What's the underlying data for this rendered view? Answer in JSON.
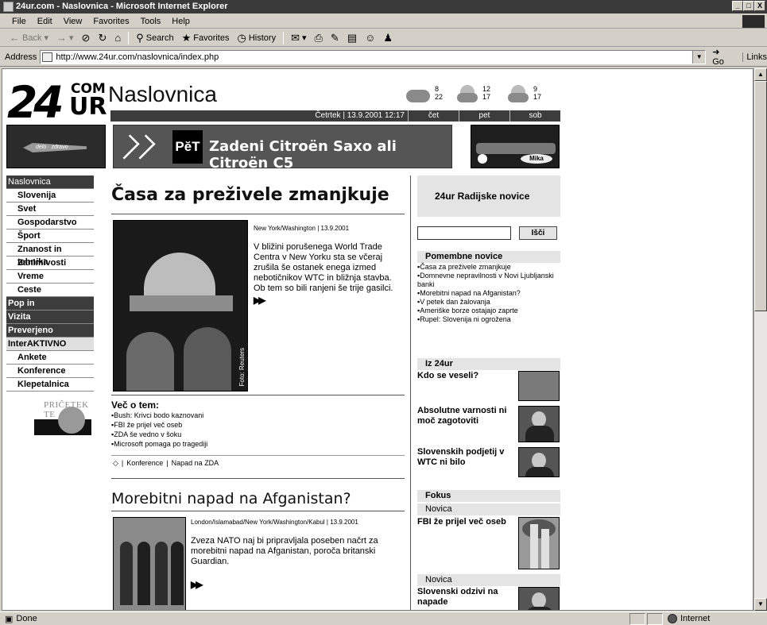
{
  "window": {
    "title": "24ur.com - Naslovnica - Microsoft Internet Explorer",
    "controls": [
      "_",
      "□",
      "X"
    ]
  },
  "menu": [
    "File",
    "Edit",
    "View",
    "Favorites",
    "Tools",
    "Help"
  ],
  "toolbar": {
    "back": "Back",
    "search": "Search",
    "favorites": "Favorites",
    "history": "History"
  },
  "address": {
    "label": "Address",
    "url": "http://www.24ur.com/naslovnica/index.php",
    "go": "Go",
    "links": "Links"
  },
  "status": {
    "text": "Done",
    "zone": "Internet"
  },
  "site": {
    "logo_num": "24",
    "logo_com": "COM",
    "logo_ur": "UR",
    "page_title": "Naslovnica",
    "date": "Četrtek | 13.9.2001 12:17",
    "forecast_days": [
      "čet",
      "pet",
      "sob"
    ],
    "forecast_temps": [
      {
        "hi": "8",
        "lo": "22"
      },
      {
        "hi": "12",
        "lo": "17"
      },
      {
        "hi": "9",
        "lo": "17"
      }
    ],
    "banner_pet": "PĕT",
    "banner_slogan": "Zadeni Citroën Saxo ali Citroën C5",
    "banner_left_text": "delo · zdravo",
    "banner_right_text": "Mika"
  },
  "nav": [
    {
      "label": "Naslovnica",
      "style": "section"
    },
    {
      "label": "Slovenija",
      "style": "item"
    },
    {
      "label": "Svet",
      "style": "item"
    },
    {
      "label": "Gospodarstvo",
      "style": "item"
    },
    {
      "label": "Šport",
      "style": "item"
    },
    {
      "label": "Znanost in tehnika",
      "style": "item"
    },
    {
      "label": "Zanimivosti",
      "style": "item"
    },
    {
      "label": "Vreme",
      "style": "item"
    },
    {
      "label": "Ceste",
      "style": "item"
    },
    {
      "label": "Pop in",
      "style": "section-bold"
    },
    {
      "label": "Vizita",
      "style": "section-bold"
    },
    {
      "label": "Preverjeno",
      "style": "section-bold"
    },
    {
      "label": "InterAKTIVNO",
      "style": "light"
    },
    {
      "label": "Ankete",
      "style": "item"
    },
    {
      "label": "Konference",
      "style": "item"
    },
    {
      "label": "Klepetalnica",
      "style": "item"
    }
  ],
  "promo": {
    "text": "PRIČETEK TE"
  },
  "lead": {
    "title": "Časa za preživele zmanjkuje",
    "meta": "New York/Washington | 13.9.2001",
    "text": "V bližini porušenega World Trade Centra v New Yorku sta se včeraj zrušila še ostanek enega izmed nebotičnikov WTC in bližnja stavba. Ob tem so bili ranjeni še trije gasilci.",
    "photo_credit": "Foto: Reuters",
    "more_head": "Več o tem:",
    "more": [
      "Bush: Krivci bodo kaznovani",
      "FBI že prijel več oseb",
      "ZDA še vedno v šoku",
      "Microsoft pomaga po tragediji"
    ],
    "conference": "Konference",
    "conference_topic": "Napad na ZDA"
  },
  "second": {
    "title": "Morebitni napad na Afganistan?",
    "meta": "London/Islamabad/New York/Washington/Kabul | 13.9.2001",
    "text": "Zveza NATO naj bi pripravljala poseben načrt za morebitni napad na Afganistan, poroča britanski Guardian."
  },
  "right": {
    "radio": "24ur Radijske novice",
    "search_button": "Išči",
    "important_head": "Pomembne novice",
    "important": [
      "Časa za preživele zmanjkuje",
      "Domnevne nepravilnosti v Novi Ljubljanski banki",
      "Morebitni napad na Afganistan?",
      "V petek dan žalovanja",
      "Ameriške borze ostajajo zaprte",
      "Rupel: Slovenija ni ogrožena"
    ],
    "iz_head": "Iz 24ur",
    "iz": [
      "Kdo se veseli?",
      "Absolutne varnosti ni moč zagotoviti",
      "Slovenskih podjetij v WTC ni bilo"
    ],
    "fokus_head": "Fokus",
    "fokus": [
      {
        "tag": "Novica",
        "title": "FBI že prijel več oseb"
      },
      {
        "tag": "Novica",
        "title": "Slovenski odzivi na napade"
      }
    ]
  }
}
